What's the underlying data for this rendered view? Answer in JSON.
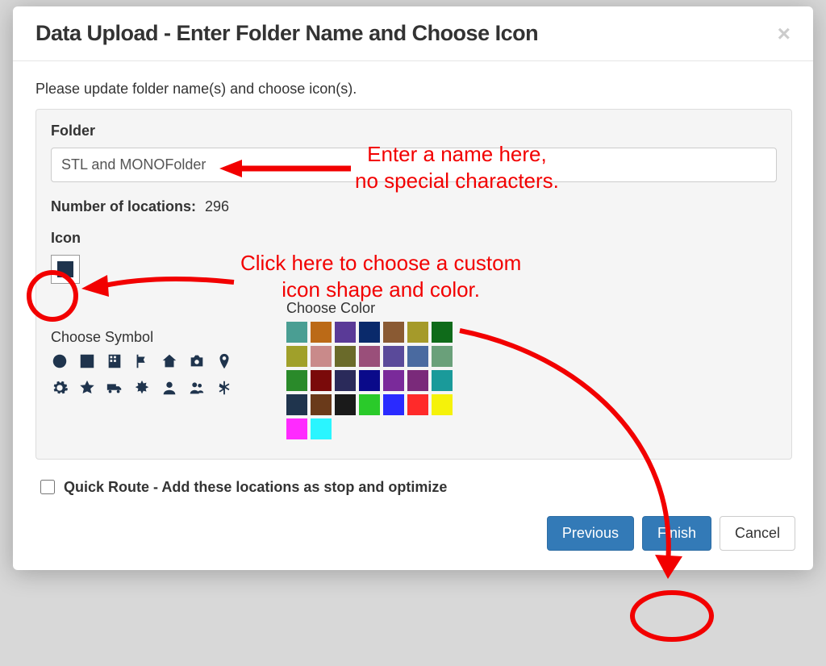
{
  "modal": {
    "title": "Data Upload - Enter Folder Name and Choose Icon",
    "instruction": "Please update folder name(s) and choose icon(s).",
    "close_label": "×"
  },
  "panel": {
    "folder_label": "Folder",
    "folder_value": "STL and MONOFolder",
    "locations_label": "Number of locations:",
    "locations_count": "296",
    "icon_label": "Icon",
    "choose_symbol_label": "Choose Symbol",
    "choose_color_label": "Choose Color"
  },
  "colors": {
    "row1": [
      "#4a9e93",
      "#bb6a17",
      "#5a3a97",
      "#0a2a6b",
      "#8a5a33",
      "#a59a2a",
      "#0f6b1a"
    ],
    "row2": [
      "#a0a02a",
      "#c98a8a",
      "#6a6a2a",
      "#9a4f7a",
      "#5a4a9a",
      "#4a6aa0",
      "#6aa07a"
    ],
    "row3": [
      "#2a8a2a",
      "#7a0a0a",
      "#2a2a5a",
      "#0a0a8a",
      "#7a2a9a",
      "#7a2a7a",
      "#1a9a9a"
    ],
    "row4": [
      "#1f344d",
      "#6a3a1a",
      "#1a1a1a",
      "#2aca2a",
      "#2a2aff",
      "#ff2a2a",
      "#f5f20a"
    ],
    "row5": [
      "#ff2aff",
      "#2af5ff"
    ]
  },
  "quick_route": {
    "label": "Quick Route - Add these locations as stop and optimize"
  },
  "footer": {
    "previous": "Previous",
    "finish": "Finish",
    "cancel": "Cancel"
  },
  "annotations": {
    "line1": "Enter a name here,",
    "line2": "no special characters.",
    "line3": "Click here to choose a custom",
    "line4": "icon shape and color."
  }
}
